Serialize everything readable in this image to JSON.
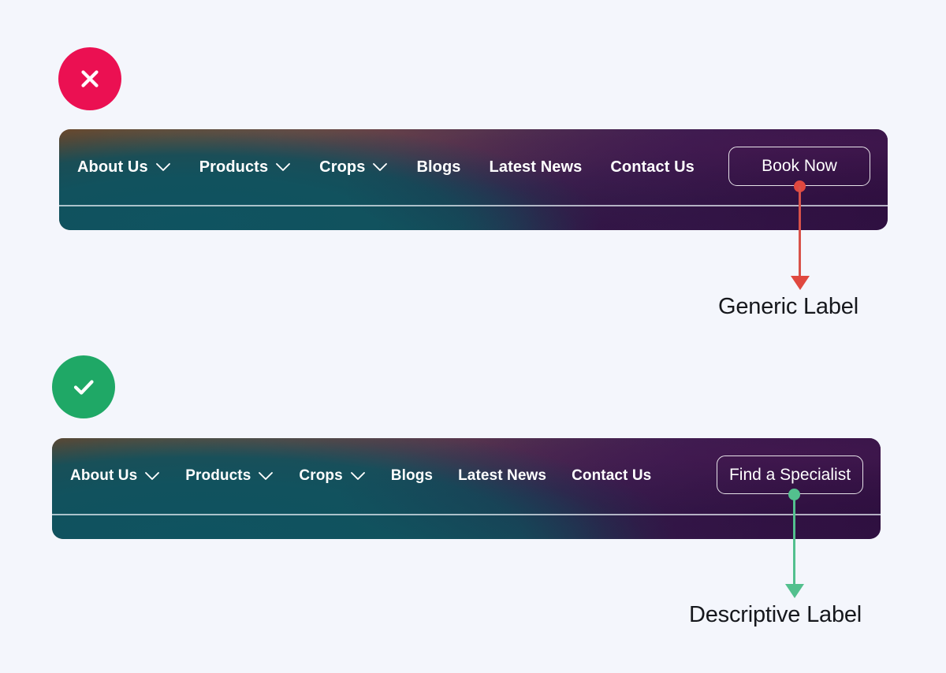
{
  "page": {
    "background_color": "#f4f6fc",
    "text_color": "#16181d"
  },
  "examples": [
    {
      "id": "bad-example",
      "status": {
        "kind": "cross",
        "icon": "close-icon",
        "color": "#eb1052"
      },
      "navbar": {
        "nav_items": [
          {
            "label": "About Us",
            "has_dropdown": true
          },
          {
            "label": "Products",
            "has_dropdown": true
          },
          {
            "label": "Crops",
            "has_dropdown": true
          },
          {
            "label": "Blogs",
            "has_dropdown": false
          },
          {
            "label": "Latest News",
            "has_dropdown": false
          },
          {
            "label": "Contact Us",
            "has_dropdown": false
          }
        ],
        "cta_label": "Book Now"
      },
      "annotation": {
        "label": "Generic Label",
        "color": "#e0483f"
      }
    },
    {
      "id": "good-example",
      "status": {
        "kind": "check",
        "icon": "check-icon",
        "color": "#1fa866"
      },
      "navbar": {
        "nav_items": [
          {
            "label": "About Us",
            "has_dropdown": true
          },
          {
            "label": "Products",
            "has_dropdown": true
          },
          {
            "label": "Crops",
            "has_dropdown": true
          },
          {
            "label": "Blogs",
            "has_dropdown": false
          },
          {
            "label": "Latest News",
            "has_dropdown": false
          },
          {
            "label": "Contact Us",
            "has_dropdown": false
          }
        ],
        "cta_label": "Find a Specialist"
      },
      "annotation": {
        "label": "Descriptive Label",
        "color": "#53c08e"
      }
    }
  ],
  "icons": {
    "chevron_down": "chevron-down-icon",
    "close": "close-icon",
    "check": "check-icon"
  }
}
